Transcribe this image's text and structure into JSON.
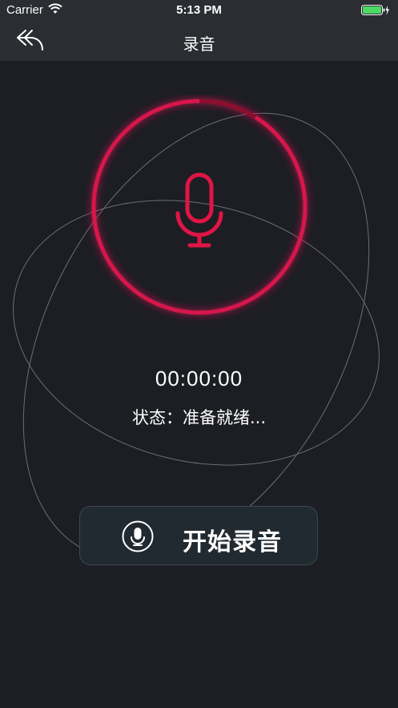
{
  "status_bar": {
    "carrier": "Carrier",
    "time": "5:13 PM",
    "icons": [
      "wifi-icon",
      "battery-icon"
    ],
    "battery_color": "#4cd964"
  },
  "nav": {
    "title": "录音",
    "back_icon": "back-arrow-icon"
  },
  "recorder": {
    "mic_icon": "microphone-icon",
    "accent_color": "#e0134f",
    "timer": "00:00:00",
    "status": "状态：准备就绪..."
  },
  "actions": {
    "start_label": "开始录音",
    "start_icon": "microphone-circle-icon"
  },
  "colors": {
    "background": "#1c1e24",
    "bar": "#2a2d31",
    "button_bg": "#222a31"
  }
}
